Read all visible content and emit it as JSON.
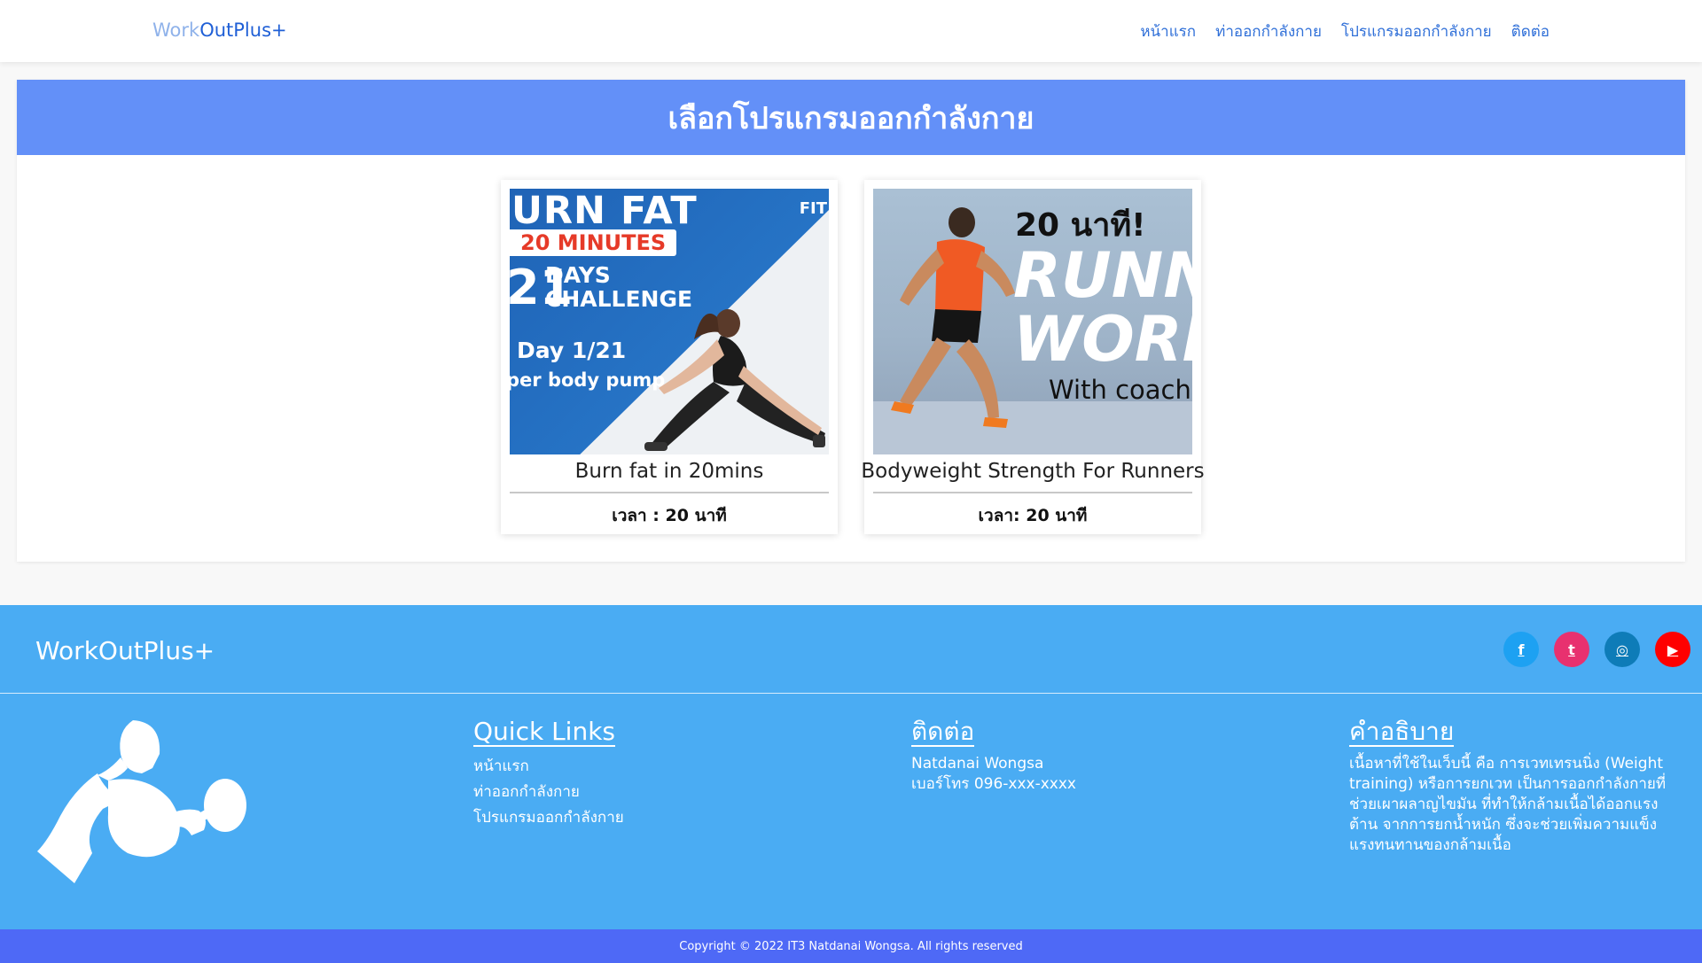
{
  "navbar": {
    "brand_part1": "Work",
    "brand_part2": "OutPlus+",
    "links": [
      "หน้าแรก",
      "ท่าออกกำลังกาย",
      "โปรแกรมออกกำลังกาย",
      "ติดต่อ"
    ]
  },
  "main": {
    "title": "เลือกโปรแกรมออกกำลังกาย",
    "cards": [
      {
        "title": "Burn fat in 20mins",
        "time": "เวลา : 20 นาที",
        "image_text": {
          "line1": "URN FAT",
          "minutes_prefix": "20",
          "minutes": " MINUTES",
          "num": "21",
          "days": "DAYS",
          "challenge": "CHALLENGE",
          "day": "Day 1/21",
          "sub": "per body pump",
          "brand": "FIT"
        }
      },
      {
        "title": "Bodyweight Strength For Runners",
        "time": "เวลา: 20 นาที",
        "image_text": {
          "top": "20 นาที!",
          "runner": "RUNNER",
          "workout": "WORKOU",
          "coach": "With coach"
        }
      }
    ]
  },
  "footer": {
    "brand": "WorkOutPlus+",
    "socials": [
      {
        "name": "facebook-icon",
        "glyph": "f"
      },
      {
        "name": "twitter-icon",
        "glyph": "t"
      },
      {
        "name": "instagram-icon",
        "glyph": "◎"
      },
      {
        "name": "youtube-icon",
        "glyph": "▶"
      }
    ],
    "quick_links": {
      "heading": "Quick Links",
      "items": [
        "หน้าแรก",
        "ท่าออกกำลังกาย",
        "โปรแกรมออกกำลังกาย"
      ]
    },
    "contact": {
      "heading": "ติดต่อ",
      "name": "Natdanai Wongsa",
      "phone": "เบอร์โทร 096-xxx-xxxx"
    },
    "about": {
      "heading": "คำอธิบาย",
      "text": "เนื้อหาที่ใช้ในเว็บนี้ คือ การเวทเทรนนิ่ง (Weight training) หรือการยกเวท เป็นการออกกำลังกายที่ช่วยเผาผลาญไขมัน ที่ทำให้กล้ามเนื้อได้ออกแรงต้าน จากการยกน้ำหนัก ซึ่งจะช่วยเพิ่มความแข็งแรงทนทานของกล้ามเนื้อ"
    },
    "copyright": "Copyright © 2022 IT3 Natdanai Wongsa. All rights reserved"
  },
  "colors": {
    "header_blue": "#6390f8",
    "footer_blue": "#4aacf3",
    "copyright_blue": "#4e69f6",
    "nav_link": "#2f6fd8"
  }
}
